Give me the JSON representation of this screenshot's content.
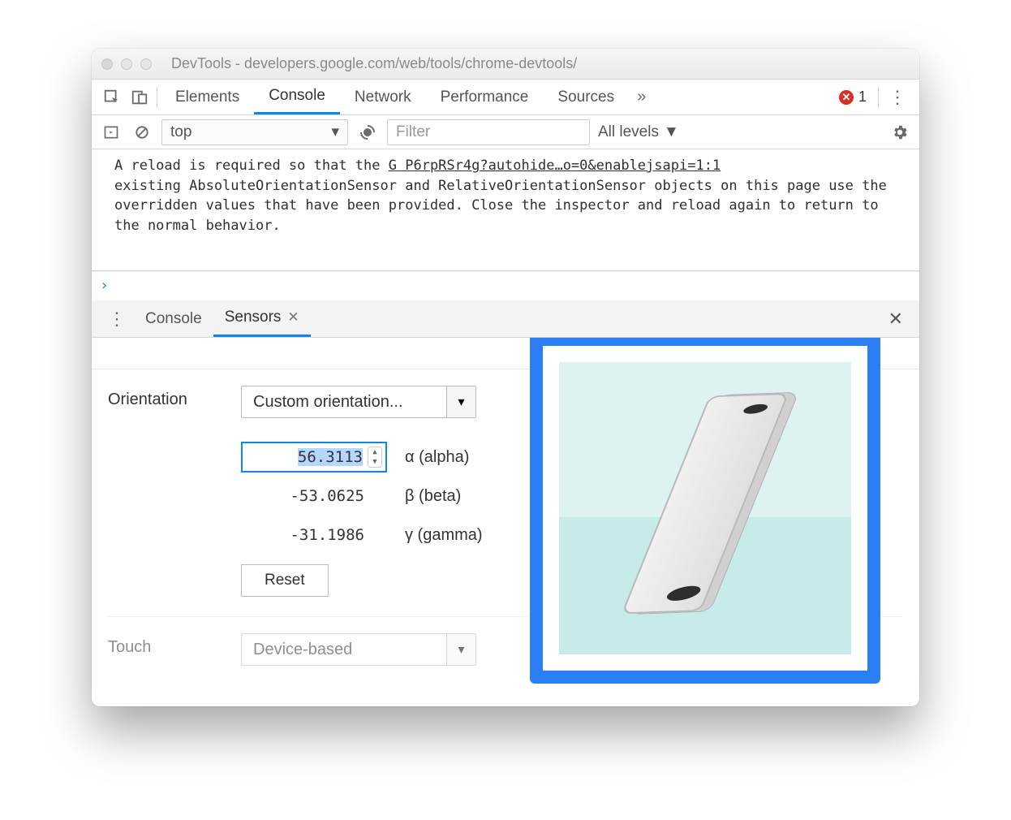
{
  "window": {
    "title": "DevTools - developers.google.com/web/tools/chrome-devtools/"
  },
  "tabs": {
    "items": [
      "Elements",
      "Console",
      "Network",
      "Performance",
      "Sources"
    ],
    "active": "Console",
    "error_count": "1"
  },
  "console_toolbar": {
    "context": "top",
    "filter_placeholder": "Filter",
    "levels_label": "All levels"
  },
  "console_message": {
    "prefix": "A reload is required so that the ",
    "link": "G P6rpRSr4g?autohide…o=0&enablejsapi=1:1",
    "rest": "existing AbsoluteOrientationSensor and RelativeOrientationSensor objects on this page use the overridden values that have been provided. Close the inspector and reload again to return to the normal behavior."
  },
  "drawer": {
    "tabs": [
      "Console",
      "Sensors"
    ],
    "active": "Sensors"
  },
  "sensors": {
    "orientation_label": "Orientation",
    "orientation_select": "Custom orientation...",
    "alpha": {
      "value": "56.3113",
      "label": "α (alpha)"
    },
    "beta": {
      "value": "-53.0625",
      "label": "β (beta)"
    },
    "gamma": {
      "value": "-31.1986",
      "label": "γ (gamma)"
    },
    "reset_label": "Reset",
    "touch_label": "Touch",
    "touch_select": "Device-based"
  }
}
